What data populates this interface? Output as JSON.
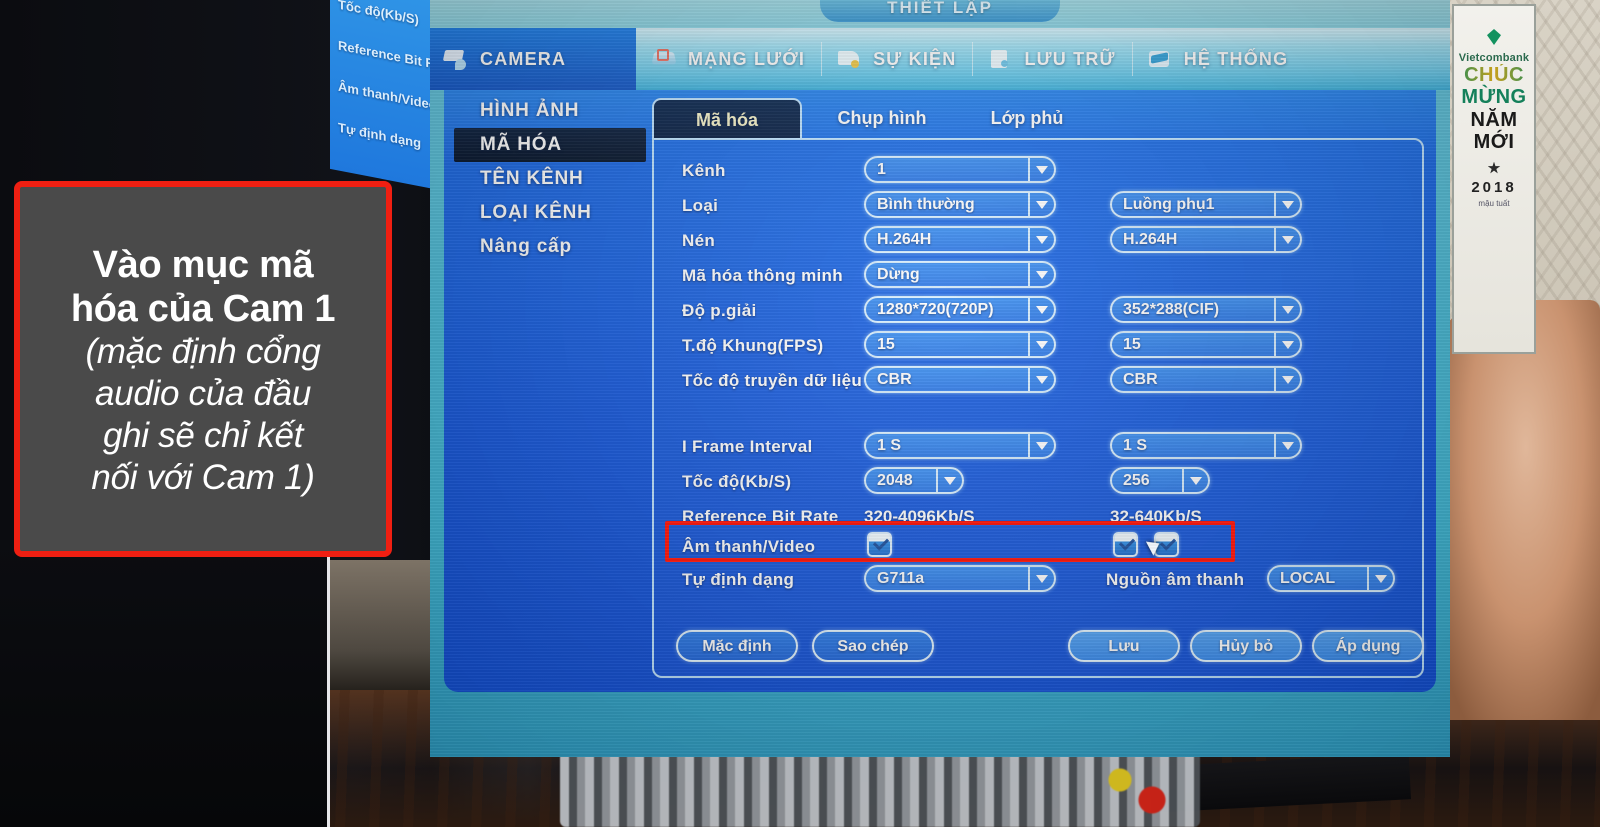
{
  "window": {
    "title": "THIẾT LẬP"
  },
  "topnav": [
    {
      "label": "CAMERA",
      "icon": "camera-icon",
      "selected": true
    },
    {
      "label": "MẠNG LƯỚI",
      "icon": "network-icon",
      "selected": false
    },
    {
      "label": "SỰ KIỆN",
      "icon": "event-icon",
      "selected": false
    },
    {
      "label": "LƯU TRỮ",
      "icon": "storage-icon",
      "selected": false
    },
    {
      "label": "HỆ THỐNG",
      "icon": "system-icon",
      "selected": false
    }
  ],
  "sidebar": {
    "items": [
      {
        "label": "HÌNH ẢNH",
        "selected": false
      },
      {
        "label": "MÃ HÓA",
        "selected": true
      },
      {
        "label": "TÊN KÊNH",
        "selected": false
      },
      {
        "label": "LOẠI KÊNH",
        "selected": false
      },
      {
        "label": "Nâng cấp",
        "selected": false
      }
    ]
  },
  "tabs": [
    {
      "label": "Mã hóa",
      "selected": true
    },
    {
      "label": "Chụp hình",
      "selected": false
    },
    {
      "label": "Lớp phủ",
      "selected": false
    }
  ],
  "form": {
    "channel": {
      "label": "Kênh",
      "main": "1"
    },
    "type": {
      "label": "Loại",
      "main": "Bình thường",
      "sub": "Luồng phụ1"
    },
    "compression": {
      "label": "Nén",
      "main": "H.264H",
      "sub": "H.264H"
    },
    "smart_codec": {
      "label": "Mã hóa thông minh",
      "main": "Dừng"
    },
    "resolution": {
      "label": "Độ p.giải",
      "main": "1280*720(720P)",
      "sub": "352*288(CIF)"
    },
    "fps": {
      "label": "T.độ Khung(FPS)",
      "main": "15",
      "sub": "15"
    },
    "bitrate_type": {
      "label": "Tốc độ truyền dữ liệu",
      "main": "CBR",
      "sub": "CBR"
    },
    "iframe": {
      "label": "I Frame Interval",
      "main": "1 S",
      "sub": "1 S"
    },
    "bitrate": {
      "label": "Tốc độ(Kb/S)",
      "main": "2048",
      "sub": "256"
    },
    "ref_bitrate": {
      "label": "Reference Bit Rate",
      "main": "320-4096Kb/S",
      "sub": "32-640Kb/S"
    },
    "audio_video": {
      "label": "Âm thanh/Video",
      "main_checked": true,
      "sub_checked": true,
      "sub2_checked": true
    },
    "format": {
      "label": "Tự định dạng",
      "main": "G711a"
    },
    "audio_source": {
      "label": "Nguồn âm thanh",
      "main": "LOCAL"
    }
  },
  "buttons": {
    "default": "Mặc định",
    "copy": "Sao chép",
    "save": "Lưu",
    "cancel": "Hủy bỏ",
    "apply": "Áp dụng"
  },
  "annotation": {
    "line1": "Vào mục mã",
    "line2": "hóa của Cam 1",
    "line3": "(mặc định cổng",
    "line4": "audio của đầu",
    "line5": "ghi sẽ chỉ kết",
    "line6": "nối với Cam 1)"
  },
  "reflection": {
    "items": [
      "Tốc độ(Kb/S)",
      "Reference Bit Rate",
      "Âm thanh/Video",
      "Tự định dạng"
    ]
  },
  "calendar": {
    "brand": "Vietcombank",
    "line1": "CHÚC",
    "line2": "MỪNG",
    "line3": "NĂM",
    "line4": "MỚI",
    "year": "2018",
    "sub": "mậu tuất"
  },
  "colors": {
    "panel_blue": "#1a5fe0",
    "accent_cyan": "#49bcd8",
    "highlight_red": "#ee1b11",
    "selected_nav": "#1558c8"
  }
}
